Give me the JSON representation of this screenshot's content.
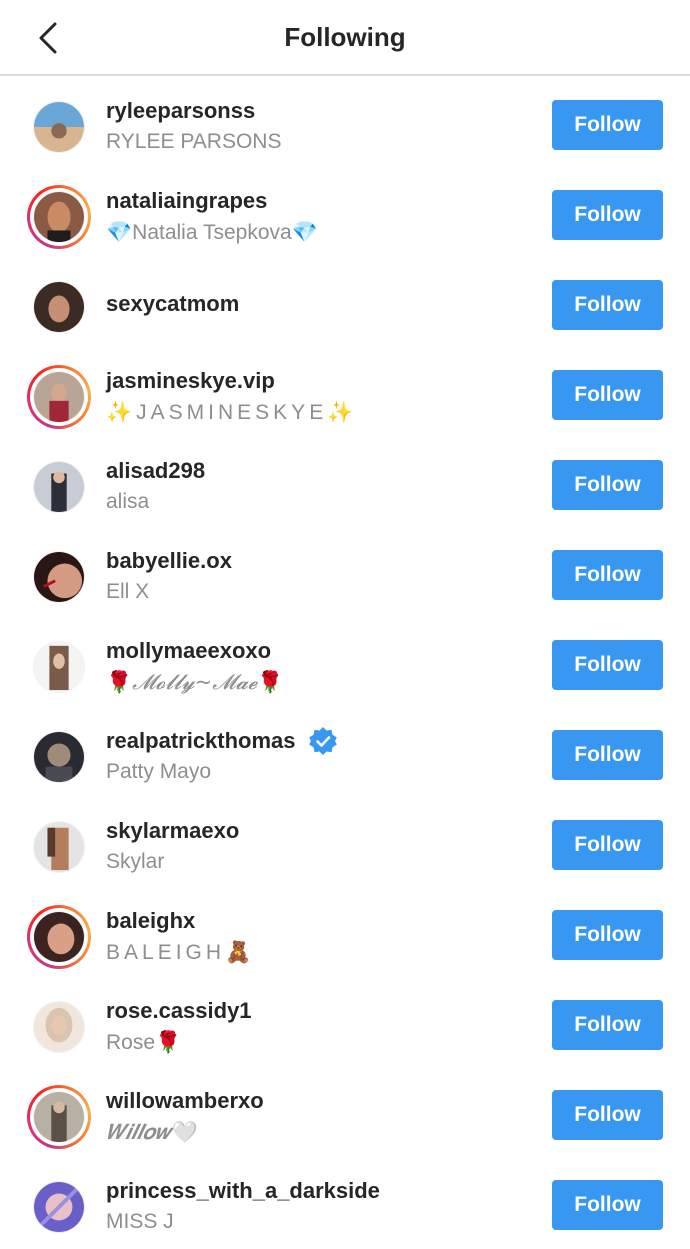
{
  "header": {
    "title": "Following",
    "back_icon": "chevron-left-icon"
  },
  "colors": {
    "follow_button": "#3897f0",
    "verified_badge": "#3897f0",
    "story_ring": "#e1306c"
  },
  "following": [
    {
      "username": "ryleeparsonss",
      "full_name": "RYLEE PARSONS",
      "verified": false,
      "story": false,
      "button": "Follow",
      "avatar_colors": [
        "#6aa6d6",
        "#d8b58e"
      ]
    },
    {
      "username": "nataliaingrapes",
      "full_name_prefix": "💎",
      "full_name": "Natalia Tsepkova",
      "full_name_suffix": "💎",
      "verified": false,
      "story": true,
      "button": "Follow",
      "avatar_colors": [
        "#8a5a44",
        "#c98b63"
      ]
    },
    {
      "username": "sexycatmom",
      "full_name": "",
      "verified": false,
      "story": false,
      "button": "Follow",
      "avatar_colors": [
        "#3c2a24",
        "#c58f74"
      ]
    },
    {
      "username": "jasmineskye.vip",
      "full_name_prefix": "✨",
      "full_name": "JASMINESKYE",
      "full_name_suffix": "✨",
      "verified": false,
      "story": true,
      "button": "Follow",
      "avatar_colors": [
        "#b9a596",
        "#a0263a"
      ]
    },
    {
      "username": "alisad298",
      "full_name": "alisa",
      "verified": false,
      "story": false,
      "button": "Follow",
      "avatar_colors": [
        "#c8ccd4",
        "#2b2f3a"
      ]
    },
    {
      "username": "babyellie.ox",
      "full_name": "Ell X",
      "verified": false,
      "story": false,
      "button": "Follow",
      "avatar_colors": [
        "#2a1612",
        "#d49a84"
      ]
    },
    {
      "username": "mollymaeexoxo",
      "full_name_prefix": "🌹",
      "full_name": "𝓜𝓸𝓵𝓵𝔂~𝓜𝓪𝓮",
      "full_name_suffix": "🌹",
      "verified": false,
      "story": false,
      "button": "Follow",
      "avatar_colors": [
        "#7a5a48",
        "#e0c0a8"
      ]
    },
    {
      "username": "realpatrickthomas",
      "full_name": "Patty Mayo",
      "verified": true,
      "story": false,
      "button": "Follow",
      "avatar_colors": [
        "#2a2a33",
        "#a08a7a"
      ]
    },
    {
      "username": "skylarmaexo",
      "full_name": "Skylar",
      "verified": false,
      "story": false,
      "button": "Follow",
      "avatar_colors": [
        "#e4e4e4",
        "#b57d5e"
      ]
    },
    {
      "username": "baleighx",
      "full_name": "BALEIGH",
      "full_name_suffix": "🧸",
      "verified": false,
      "story": true,
      "button": "Follow",
      "avatar_colors": [
        "#3a2320",
        "#d9a088"
      ]
    },
    {
      "username": "rose.cassidy1",
      "full_name": "Rose",
      "full_name_suffix": "🌹",
      "verified": false,
      "story": false,
      "button": "Follow",
      "avatar_colors": [
        "#d9c4b0",
        "#f0e6de"
      ]
    },
    {
      "username": "willowamberxo",
      "full_name": "𝑾𝒊𝒍𝒍𝒐𝒘",
      "full_name_suffix": "🤍",
      "verified": false,
      "story": true,
      "button": "Follow",
      "avatar_colors": [
        "#b7b0a4",
        "#5a5048"
      ]
    },
    {
      "username": "princess_with_a_darkside",
      "full_name": "MISS J",
      "verified": false,
      "story": false,
      "button": "Follow",
      "avatar_colors": [
        "#6a5fc8",
        "#e8c0c8"
      ]
    }
  ]
}
